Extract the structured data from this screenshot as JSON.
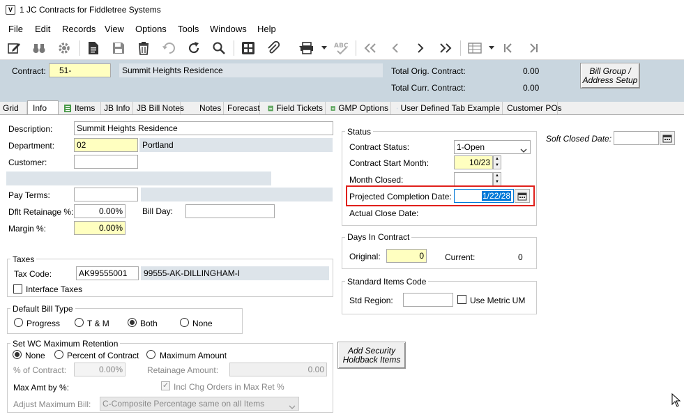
{
  "window": {
    "title": "1 JC Contracts for Fiddletree Systems",
    "icon_letter": "V"
  },
  "menu": [
    "File",
    "Edit",
    "Records",
    "View",
    "Options",
    "Tools",
    "Windows",
    "Help"
  ],
  "toolbar": {
    "icons": [
      "edit-icon",
      "binoculars-icon",
      "gear-icon",
      "new-document-icon",
      "save-icon",
      "delete-icon",
      "undo-icon",
      "refresh-icon",
      "search-icon",
      "calculator-icon",
      "attach-icon",
      "print-icon",
      "spellcheck-icon",
      "first-record-icon",
      "prev-record-icon",
      "next-record-icon",
      "last-record-icon",
      "grid-icon",
      "jump-first-icon",
      "jump-last-icon"
    ]
  },
  "header": {
    "contract_label": "Contract:",
    "contract_value": "51-",
    "contract_desc": "Summit Heights Residence",
    "orig_label": "Total Orig. Contract:",
    "orig_value": "0.00",
    "curr_label": "Total Curr. Contract:",
    "curr_value": "0.00",
    "bill_group_btn": "Bill Group / Address Setup"
  },
  "tabs": [
    "Grid",
    "Info",
    "Items",
    "JB Info",
    "JB Bill Notes",
    "Notes",
    "Forecast",
    "Field Tickets",
    "GMP Options",
    "User Defined Tab Example",
    "Customer POs"
  ],
  "info": {
    "description_label": "Description:",
    "description_value": "Summit Heights Residence",
    "department_label": "Department:",
    "department_value": "02",
    "department_desc": "Portland",
    "customer_label": "Customer:",
    "customer_value": "",
    "pay_terms_label": "Pay Terms:",
    "pay_terms_value": "",
    "dflt_retainage_label": "Dflt Retainage %:",
    "dflt_retainage_value": "0.00%",
    "bill_day_label": "Bill Day:",
    "bill_day_value": "",
    "margin_label": "Margin %:",
    "margin_value": "0.00%"
  },
  "taxes": {
    "title": "Taxes",
    "tax_code_label": "Tax Code:",
    "tax_code_value": "AK99555001",
    "tax_code_desc": "99555-AK-DILLINGHAM-I",
    "interface_label": "Interface Taxes"
  },
  "bill_type": {
    "title": "Default Bill Type",
    "options": [
      "Progress",
      "T & M",
      "Both",
      "None"
    ],
    "selected": "Both"
  },
  "wc": {
    "title": "Set WC Maximum Retention",
    "options": [
      "None",
      "Percent of Contract",
      "Maximum Amount"
    ],
    "selected": "None",
    "pct_label": "% of Contract:",
    "pct_value": "0.00%",
    "ret_amount_label": "Retainage Amount:",
    "ret_amount_value": "0.00",
    "max_amt_label": "Max Amt by %:",
    "incl_chg_label": "Incl Chg Orders in Max Ret %",
    "adjust_label": "Adjust Maximum Bill:",
    "adjust_value": "C-Composite Percentage same on all Items"
  },
  "security_btn": "Add Security Holdback Items",
  "status": {
    "title": "Status",
    "contract_status_label": "Contract Status:",
    "contract_status_value": "1-Open",
    "start_month_label": "Contract Start Month:",
    "start_month_value": "10/23",
    "month_closed_label": "Month Closed:",
    "month_closed_value": "",
    "projected_label": "Projected Completion Date:",
    "projected_value": "1/22/28",
    "actual_close_label": "Actual Close Date:"
  },
  "days": {
    "title": "Days In Contract",
    "original_label": "Original:",
    "original_value": "0",
    "current_label": "Current:",
    "current_value": "0"
  },
  "std_items": {
    "title": "Standard Items Code",
    "region_label": "Std Region:",
    "region_value": "",
    "metric_label": "Use Metric UM"
  },
  "soft_closed": {
    "label": "Soft Closed Date:",
    "value": ""
  },
  "colors": {
    "highlight": "#e0201b",
    "selection": "#0078d7",
    "yellow": "#ffffc0",
    "header": "#c9d6df"
  }
}
